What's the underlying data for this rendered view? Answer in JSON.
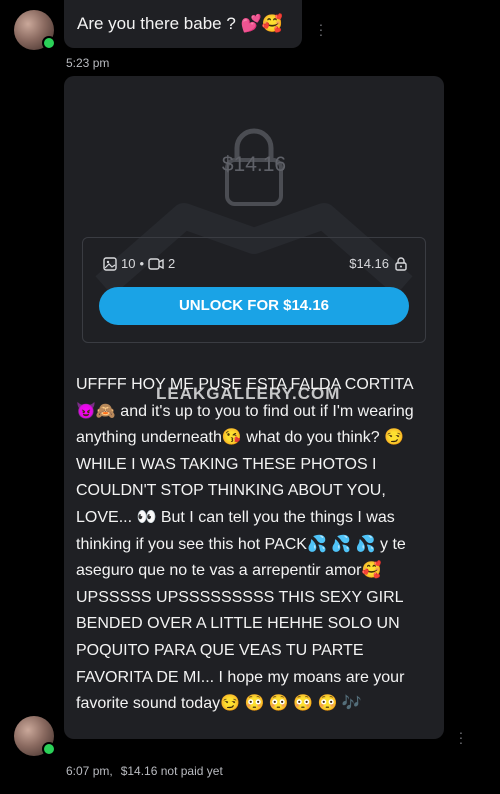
{
  "messages": [
    {
      "text": "Are you there babe ? 💕🥰",
      "time": "5:23 pm"
    }
  ],
  "ppv": {
    "price_display": "$14.16",
    "photo_count": "10",
    "video_count": "2",
    "price_small": "$14.16",
    "unlock_label": "UNLOCK FOR $14.16",
    "message": "UFFFF HOY ME PUSE ESTA FALDA CORTITA 😈🙈 and it's up to you to find out if I'm wearing anything underneath😘 what do you think? 😏 WHILE I WAS TAKING THESE PHOTOS I COULDN'T STOP THINKING ABOUT YOU, LOVE... 👀 But I can tell you the things I was thinking if you see this hot PACK💦 💦 💦 y te aseguro que no te vas a arrepentir amor🥰 UPSSSSS UPSSSSSSSSS THIS SEXY GIRL BENDED OVER A LITTLE HEHHE SOLO UN POQUITO PARA QUE VEAS TU PARTE FAVORITA DE MI... I hope my moans are your favorite sound today😏 😳 😳 😳 😳 🎶",
    "time": "6:07 pm,",
    "paid_status": "$14.16 not paid yet"
  },
  "watermark": "LEAKGALLERY.COM",
  "colors": {
    "accent": "#1aa3e6",
    "bubble": "#1f2024",
    "online": "#2bd158"
  },
  "icons": [
    "image-icon",
    "video-icon",
    "lock-icon",
    "kebab-menu-icon"
  ]
}
